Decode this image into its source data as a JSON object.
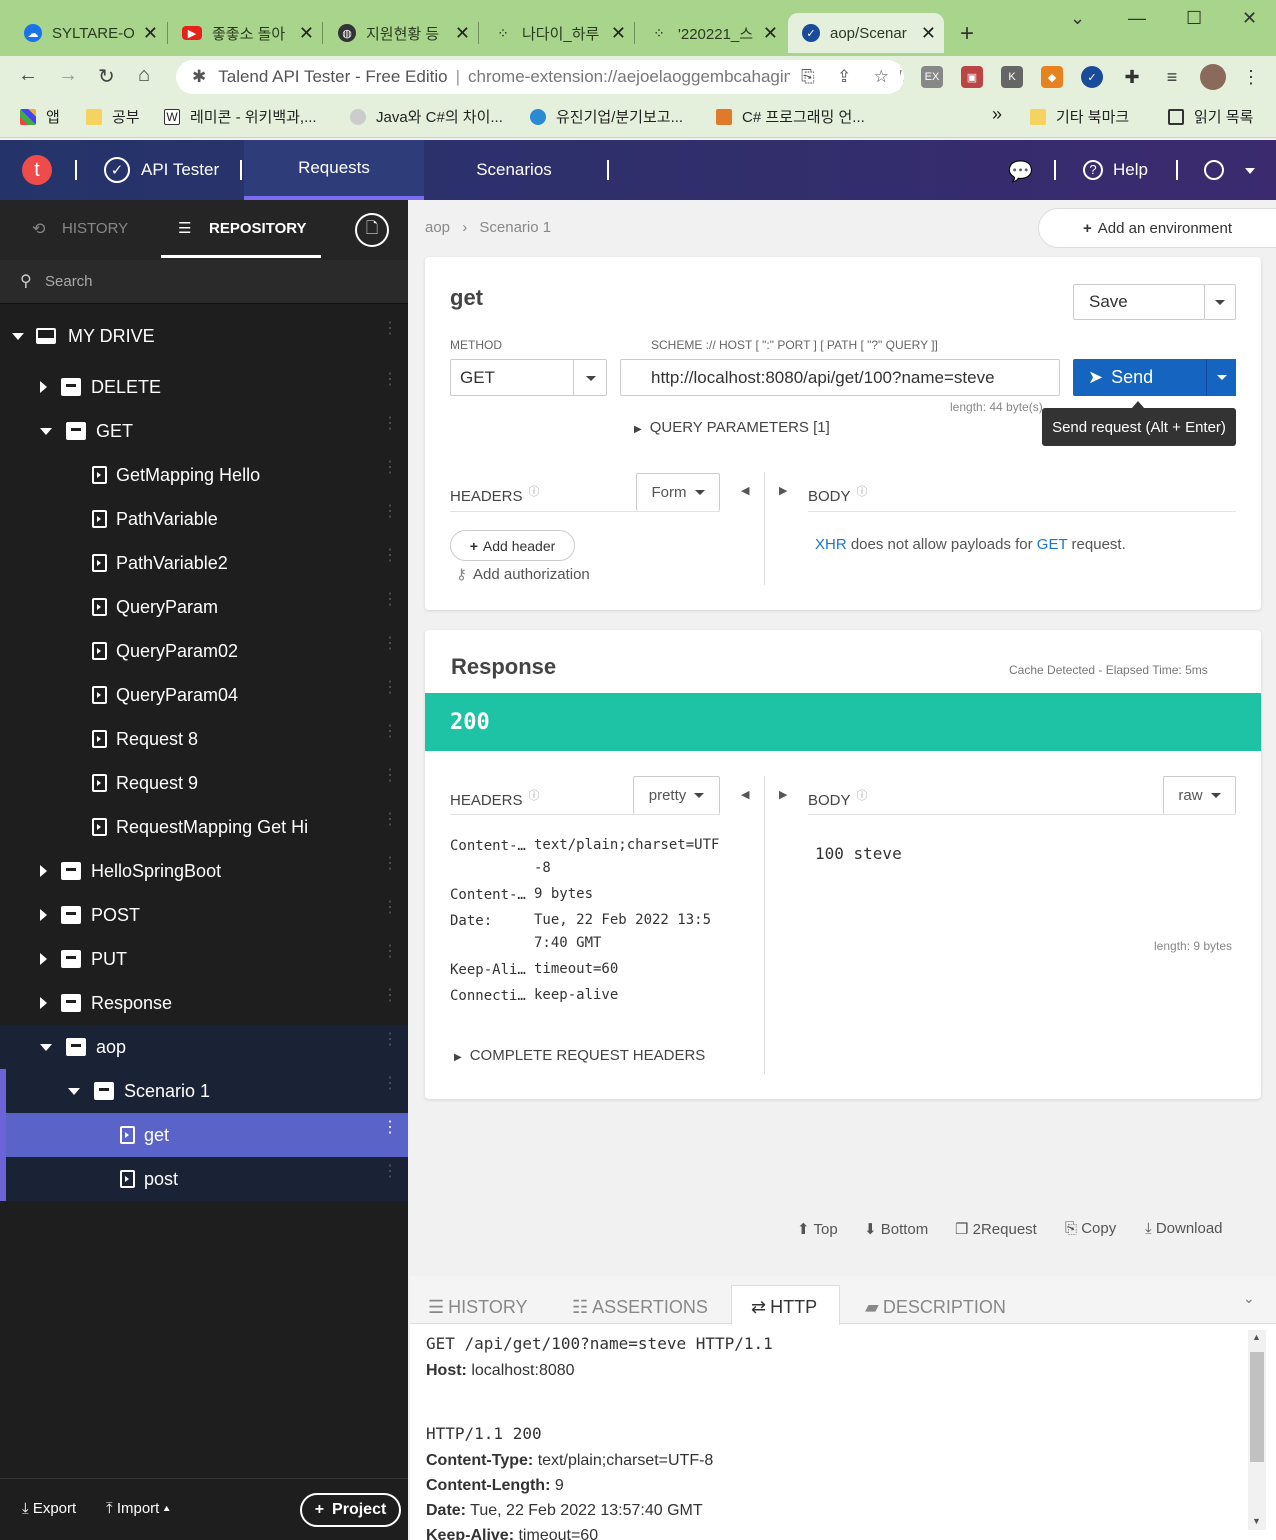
{
  "browser": {
    "tabs": [
      {
        "title": "SYLTARE-O",
        "icon": "cloud-icon",
        "color": "#1a73e8"
      },
      {
        "title": "좋좋소 돌아",
        "icon": "youtube-icon",
        "color": "#e62117"
      },
      {
        "title": "지원현황 등",
        "icon": "globe-icon",
        "color": "#333333"
      },
      {
        "title": "나다이_하루",
        "icon": "dots-icon",
        "color": "#333333"
      },
      {
        "title": "'220221_스",
        "icon": "dots-icon",
        "color": "#333333"
      },
      {
        "title": "aop/Scenar",
        "icon": "check-icon",
        "color": "#1a4a9a"
      }
    ],
    "omnibox_site": "Talend API Tester - Free Editio",
    "omnibox_url": "chrome-extension://aejoelaoggembcahagimdiliamlcdmfm/...",
    "bookmarks": [
      "앱",
      "공부",
      "레미콘 - 위키백과,...",
      "Java와 C#의 차이...",
      "유진기업/분기보고...",
      "C# 프로그래밍 언...",
      "기타 북마크",
      "읽기 목록"
    ],
    "bookmarks_more": "»"
  },
  "app": {
    "brand": "API Tester",
    "logo_letter": "t",
    "nav": [
      "Requests",
      "Scenarios"
    ],
    "help": "Help"
  },
  "sidebar": {
    "tab_history": "HISTORY",
    "tab_repository": "REPOSITORY",
    "search_placeholder": "Search",
    "drive": "MY DRIVE",
    "tree": [
      {
        "label": "DELETE",
        "type": "folder",
        "level": 1,
        "expanded": false
      },
      {
        "label": "GET",
        "type": "folder",
        "level": 1,
        "expanded": true
      },
      {
        "label": "GetMapping Hello",
        "type": "request",
        "level": 2
      },
      {
        "label": "PathVariable",
        "type": "request",
        "level": 2
      },
      {
        "label": "PathVariable2",
        "type": "request",
        "level": 2
      },
      {
        "label": "QueryParam",
        "type": "request",
        "level": 2
      },
      {
        "label": "QueryParam02",
        "type": "request",
        "level": 2
      },
      {
        "label": "QueryParam04",
        "type": "request",
        "level": 2
      },
      {
        "label": "Request 8",
        "type": "request",
        "level": 2
      },
      {
        "label": "Request 9",
        "type": "request",
        "level": 2
      },
      {
        "label": "RequestMapping Get Hi",
        "type": "request",
        "level": 2
      },
      {
        "label": "HelloSpringBoot",
        "type": "folder",
        "level": 1,
        "expanded": false
      },
      {
        "label": "POST",
        "type": "folder",
        "level": 1,
        "expanded": false
      },
      {
        "label": "PUT",
        "type": "folder",
        "level": 1,
        "expanded": false
      },
      {
        "label": "Response",
        "type": "folder",
        "level": 1,
        "expanded": false
      },
      {
        "label": "aop",
        "type": "folder",
        "level": 1,
        "expanded": true
      },
      {
        "label": "Scenario 1",
        "type": "scenario",
        "level": 2,
        "expanded": true
      },
      {
        "label": "get",
        "type": "request",
        "level": 3,
        "selected": true
      },
      {
        "label": "post",
        "type": "request",
        "level": 3
      }
    ],
    "export": "Export",
    "import": "Import",
    "project": "Project"
  },
  "breadcrumb": {
    "root": "aop",
    "current": "Scenario 1"
  },
  "add_environment": "Add an environment",
  "request": {
    "name": "get",
    "save": "Save",
    "method_label": "METHOD",
    "method": "GET",
    "url_label": "SCHEME :// HOST [ \":\" PORT ] [ PATH [ \"?\" QUERY ]]",
    "url": "http://localhost:8080/api/get/100?name=steve",
    "url_length": "length: 44 byte(s)",
    "send": "Send",
    "tooltip": "Send request (Alt + Enter)",
    "query_params": "QUERY PARAMETERS [1]",
    "headers": "HEADERS",
    "form": "Form",
    "body": "BODY",
    "add_header": "Add header",
    "add_auth": "Add authorization",
    "xhr_a": "XHR",
    "xhr_b": "does not allow payloads for",
    "xhr_c": "GET",
    "xhr_d": "request."
  },
  "response": {
    "title": "Response",
    "meta": "Cache Detected - Elapsed Time: 5ms",
    "status": "200",
    "status_color": "#1dc3a4",
    "headers": "HEADERS",
    "pretty": "pretty",
    "body": "BODY",
    "raw": "raw",
    "header_rows": [
      {
        "k": "Content-…",
        "v1": "text/plain;charset=UTF",
        "v2": "-8"
      },
      {
        "k": "Content-…",
        "v1": "9 bytes",
        "v2": ""
      },
      {
        "k": "Date:",
        "v1": "Tue, 22 Feb 2022 13:5",
        "v2": "7:40 GMT"
      },
      {
        "k": "Keep-Ali…",
        "v1": "timeout=60",
        "v2": ""
      },
      {
        "k": "Connecti…",
        "v1": "keep-alive",
        "v2": ""
      }
    ],
    "complete_headers": "COMPLETE REQUEST HEADERS",
    "body_text": "100 steve",
    "body_length": "length: 9 bytes"
  },
  "footer_actions": [
    "Top",
    "Bottom",
    "2Request",
    "Copy",
    "Download"
  ],
  "bottom_panel": {
    "tabs": [
      "HISTORY",
      "ASSERTIONS",
      "HTTP",
      "DESCRIPTION"
    ],
    "active": "HTTP",
    "request_line": "GET /api/get/100?name=steve HTTP/1.1",
    "host_key": "Host:",
    "host_val": "localhost:8080",
    "status_line": "HTTP/1.1 200",
    "resp_headers": [
      {
        "k": "Content-Type:",
        "v": "text/plain;charset=UTF-8"
      },
      {
        "k": "Content-Length:",
        "v": "9"
      },
      {
        "k": "Date:",
        "v": "Tue, 22 Feb 2022 13:57:40 GMT"
      },
      {
        "k": "Keep-Alive:",
        "v": "timeout=60"
      }
    ]
  }
}
